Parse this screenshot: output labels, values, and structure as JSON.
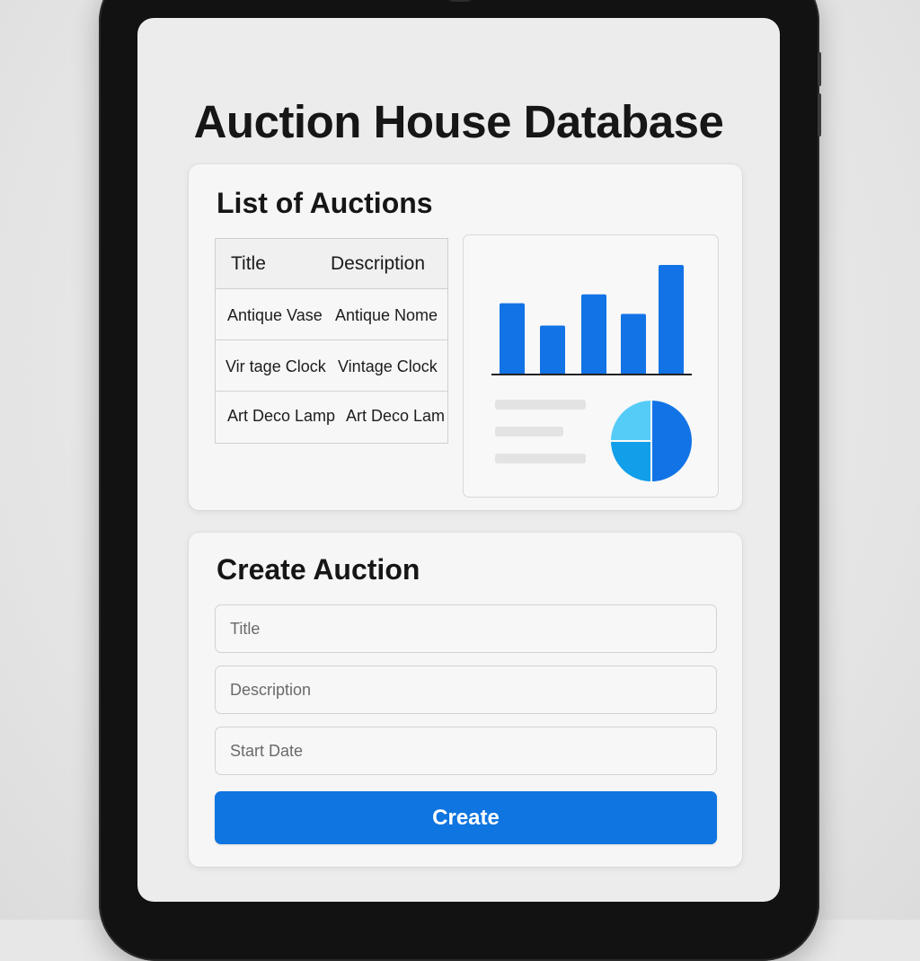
{
  "page": {
    "title": "Auction House Database"
  },
  "auction_list": {
    "title": "List of Auctions",
    "columns": [
      "Title",
      "Description"
    ],
    "rows": [
      {
        "title": "Antique Vase",
        "description": "Antique Nome"
      },
      {
        "title": "Vir tage Clock",
        "description": "Vintage Clock"
      },
      {
        "title": "Art Deco Lamp",
        "description": "Art Deco Lam"
      }
    ]
  },
  "chart_data": [
    {
      "type": "bar",
      "categories": [
        "",
        "",
        "",
        "",
        ""
      ],
      "values": [
        80,
        55,
        90,
        68,
        123
      ],
      "ylim": [
        0,
        125
      ],
      "color": "#1273e6"
    },
    {
      "type": "pie",
      "values": [
        50,
        25,
        25
      ],
      "colors": [
        "#1273e6",
        "#129fea",
        "#55ccf8"
      ]
    }
  ],
  "create_auction": {
    "title": "Create Auction",
    "fields": {
      "title_placeholder": "Title",
      "description_placeholder": "Description",
      "start_date_placeholder": "Start Date"
    },
    "button_label": "Create"
  },
  "colors": {
    "accent": "#0f75e0",
    "device_frame": "#121212",
    "card_background": "#f6f6f6",
    "page_background": "#ececec"
  },
  "icons": {
    "chart_placeholder_lines": "legend-placeholder-icon"
  }
}
